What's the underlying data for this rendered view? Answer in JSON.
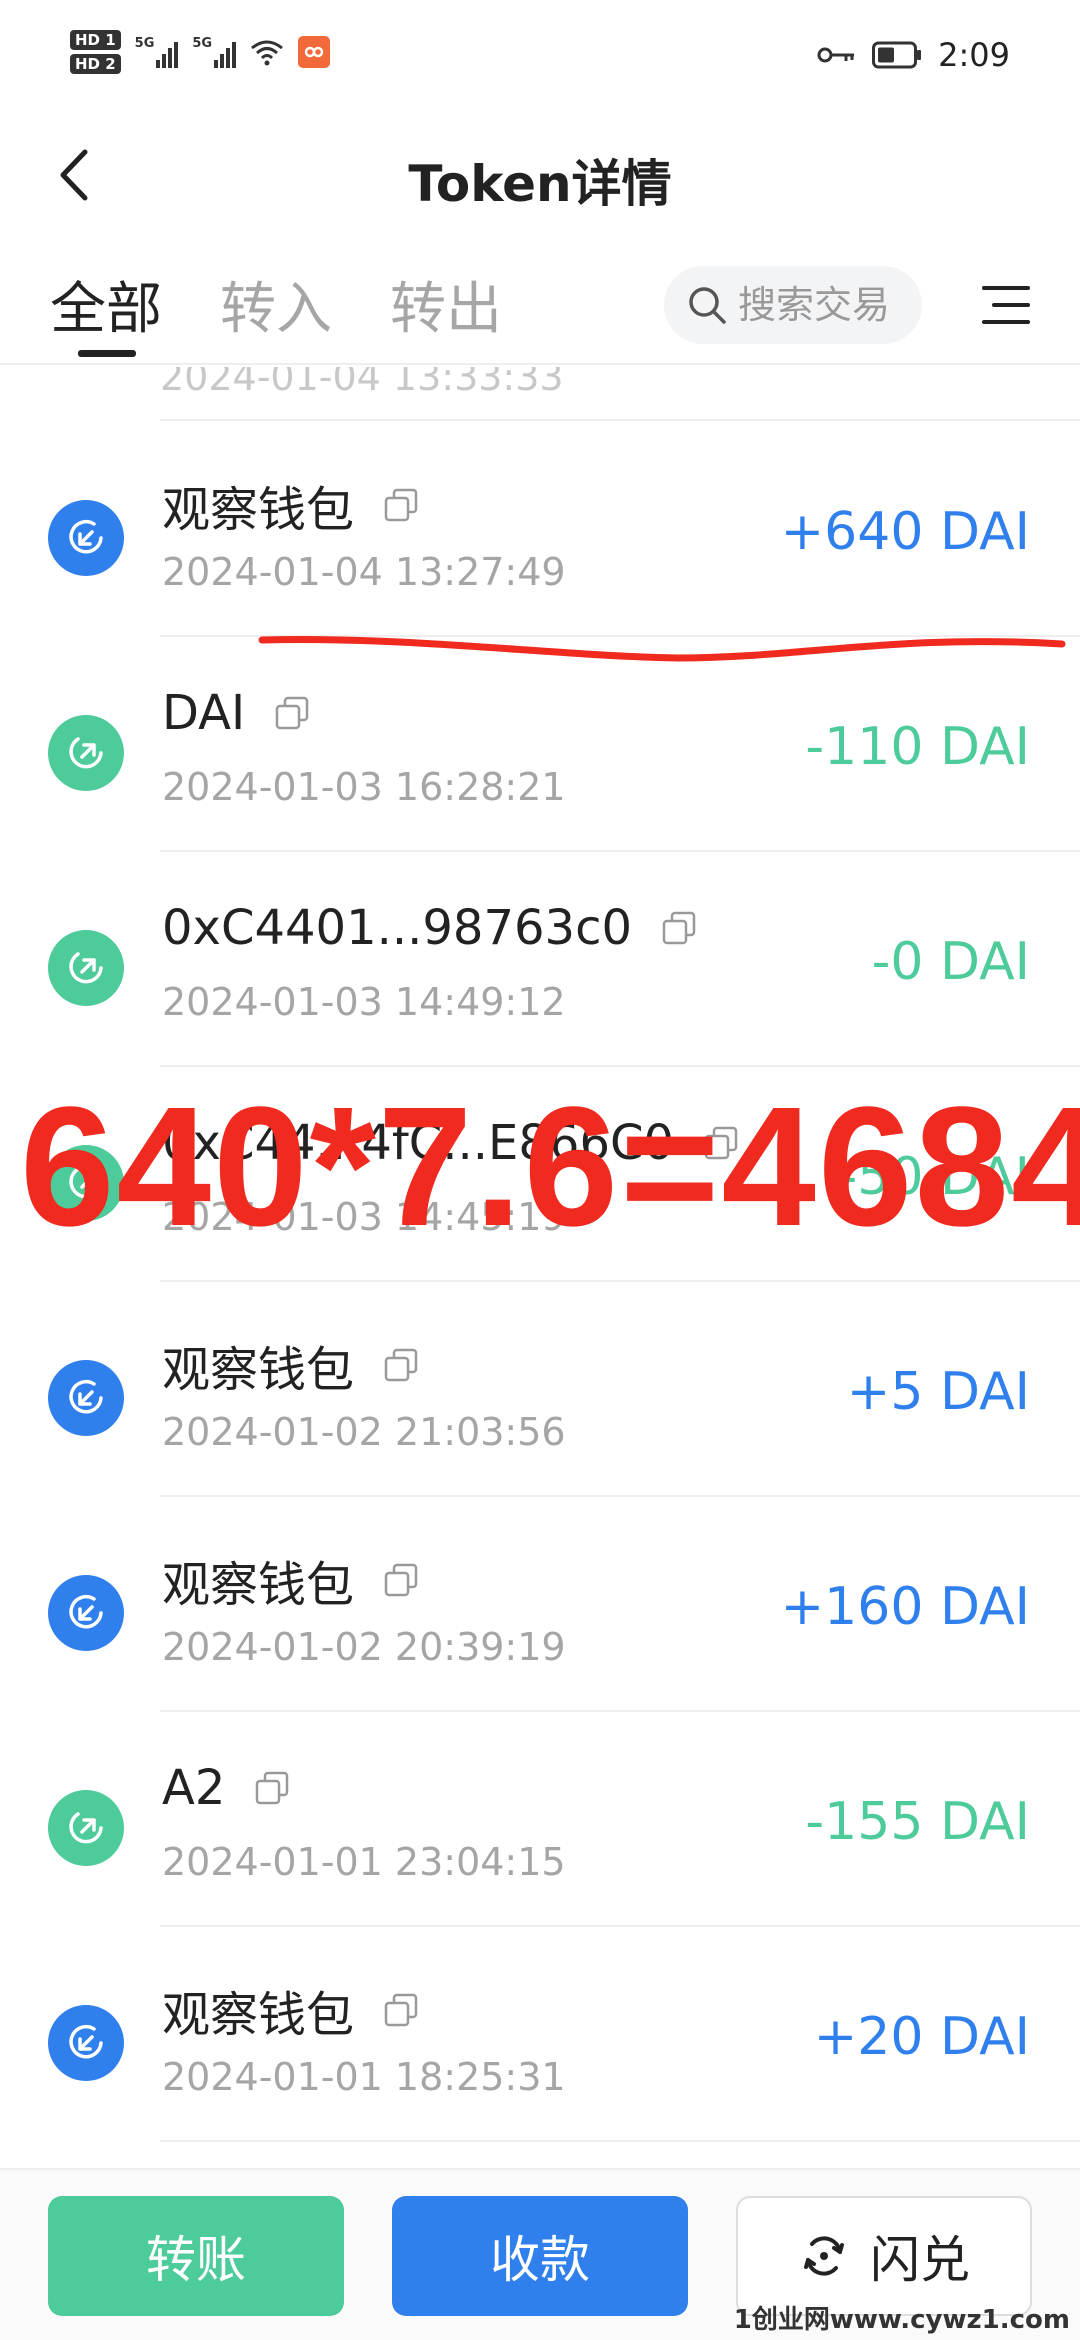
{
  "status_bar": {
    "hd_labels": [
      "HD 1",
      "HD 2"
    ],
    "signal_labels": [
      "5G",
      "5G"
    ],
    "time": "2:09"
  },
  "header": {
    "title": "Token详情"
  },
  "tabs": [
    {
      "label": "全部",
      "active": true
    },
    {
      "label": "转入",
      "active": false
    },
    {
      "label": "转出",
      "active": false
    }
  ],
  "search": {
    "placeholder": "搜索交易"
  },
  "list": {
    "partial_top_time": "2024-01-04 13:33:33",
    "transactions": [
      {
        "name": "观察钱包",
        "time": "2024-01-04 13:27:49",
        "amount": "+640 DAI",
        "direction": "in"
      },
      {
        "name": "DAI",
        "time": "2024-01-03 16:28:21",
        "amount": "-110 DAI",
        "direction": "out"
      },
      {
        "name": "0xC4401...98763c0",
        "time": "2024-01-03 14:49:12",
        "amount": "-0 DAI",
        "direction": "out"
      },
      {
        "name": "0xC44...4fC...E866C0",
        "time": "2024-01-03 14:45:19",
        "amount": "-50 DAI",
        "direction": "out"
      },
      {
        "name": "观察钱包",
        "time": "2024-01-02 21:03:56",
        "amount": "+5 DAI",
        "direction": "in"
      },
      {
        "name": "观察钱包",
        "time": "2024-01-02 20:39:19",
        "amount": "+160 DAI",
        "direction": "in"
      },
      {
        "name": "A2",
        "time": "2024-01-01 23:04:15",
        "amount": "-155 DAI",
        "direction": "out"
      },
      {
        "name": "观察钱包",
        "time": "2024-01-01 18:25:31",
        "amount": "+20 DAI",
        "direction": "in"
      }
    ]
  },
  "annotation": {
    "overlay_text": "640*7.6=4684",
    "color": "#f02a1e"
  },
  "actions": {
    "transfer": "转账",
    "receive": "收款",
    "swap": "闪兑"
  },
  "colors": {
    "incoming": "#2f80ed",
    "outgoing": "#4ecb9a"
  },
  "watermark": "1创业网www.cywz1.com"
}
